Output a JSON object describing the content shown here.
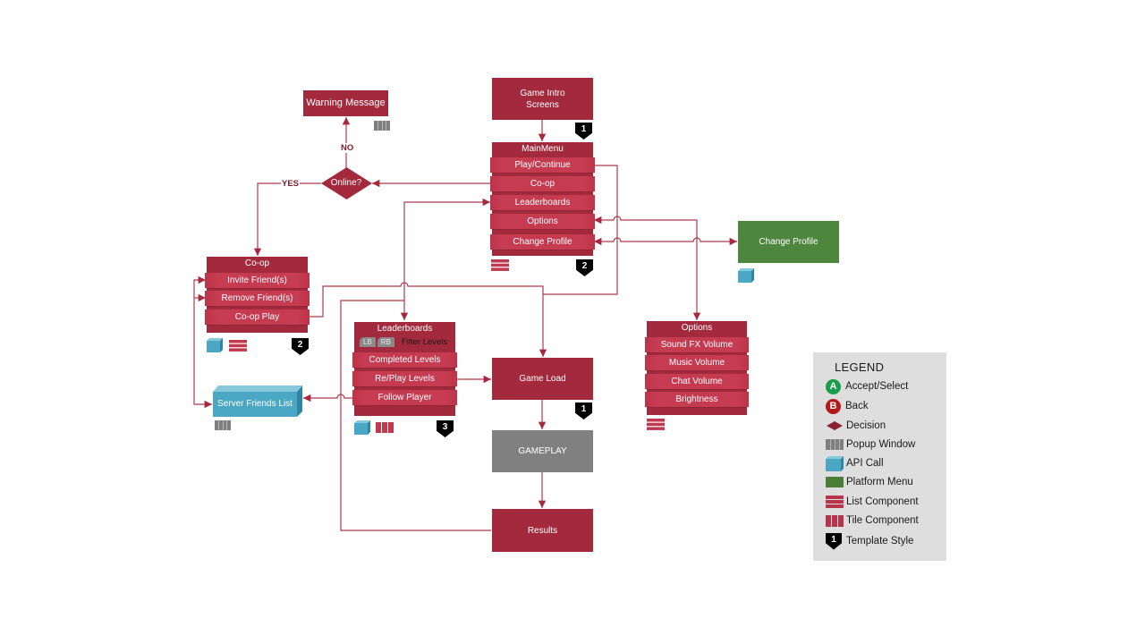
{
  "diagram": {
    "colors": {
      "node_red": "#a22a3c",
      "item_red": "#c43a4f",
      "platform_green": "#4f863e",
      "api_blue": "#4aa8c4",
      "gameplay_gray": "#808080",
      "popup_gray": "#7a7a7a",
      "connector": "#a8283d",
      "accept_green": "#1a9e4a",
      "back_red": "#b51a1a",
      "legend_bg": "#dedede"
    },
    "nodes": {
      "warning_message": {
        "label": "Warning Message",
        "icons": [
          "popup-window"
        ]
      },
      "game_intro": {
        "lines": [
          "Game Intro",
          "Screens"
        ],
        "template": "1"
      },
      "decision_online": {
        "label": "Online?"
      },
      "main_menu": {
        "title": "MainMenu",
        "items": [
          "Play/Continue",
          "Co-op",
          "Leaderboards",
          "Options",
          "Change Profile"
        ],
        "icons": [
          "list-component"
        ],
        "template": "2"
      },
      "coop": {
        "title": "Co-op",
        "items": [
          "Invite Friend(s)",
          "Remove Friend(s)",
          "Co-op Play"
        ],
        "icons": [
          "api-call",
          "list-component"
        ],
        "template": "2"
      },
      "leaderboards": {
        "title": "Leaderboards",
        "filter": {
          "buttons": [
            "LB",
            "RB"
          ],
          "label": "Filter Levels"
        },
        "items": [
          "Completed Levels",
          "Re/Play Levels",
          "Follow Player"
        ],
        "icons": [
          "api-call",
          "tile-component"
        ],
        "template": "3"
      },
      "server_friends_list": {
        "label": "Server Friends List",
        "type": "api-call",
        "icons": [
          "popup-window"
        ]
      },
      "game_load": {
        "label": "Game Load",
        "template": "1"
      },
      "gameplay": {
        "label": "GAMEPLAY"
      },
      "results": {
        "label": "Results"
      },
      "change_profile_platform": {
        "label": "Change Profile",
        "type": "platform-menu",
        "icons": [
          "api-call"
        ]
      },
      "options": {
        "title": "Options",
        "items": [
          "Sound FX Volume",
          "Music Volume",
          "Chat Volume",
          "Brightness"
        ],
        "icons": [
          "list-component"
        ]
      }
    },
    "edge_labels": {
      "yes": "YES",
      "no": "NO"
    },
    "edges": [
      {
        "from": "game_intro",
        "to": "main_menu"
      },
      {
        "from": "main_menu.Co-op",
        "to": "decision_online"
      },
      {
        "from": "decision_online",
        "to": "warning_message",
        "label": "NO"
      },
      {
        "from": "decision_online",
        "to": "coop",
        "label": "YES"
      },
      {
        "from": "main_menu.Play/Continue",
        "to": "game_load"
      },
      {
        "from": "coop.Co-op Play",
        "to": "game_load"
      },
      {
        "from": "main_menu.Leaderboards",
        "to": "leaderboards",
        "bidirectional": true
      },
      {
        "from": "results",
        "to": "leaderboards"
      },
      {
        "from": "leaderboards.Re/Play Levels",
        "to": "game_load"
      },
      {
        "from": "leaderboards.Follow Player",
        "to": "server_friends_list"
      },
      {
        "from": "server_friends_list",
        "to": "coop.Invite Friend(s)"
      },
      {
        "from": "server_friends_list",
        "to": "coop.Remove Friend(s)"
      },
      {
        "from": "game_load",
        "to": "gameplay"
      },
      {
        "from": "gameplay",
        "to": "results"
      },
      {
        "from": "main_menu.Options",
        "to": "options",
        "bidirectional": true
      },
      {
        "from": "main_menu.Change Profile",
        "to": "change_profile_platform",
        "bidirectional": true
      }
    ],
    "legend": {
      "title": "LEGEND",
      "items": [
        {
          "icon": "accept-button-icon",
          "glyph": "A",
          "label": "Accept/Select"
        },
        {
          "icon": "back-button-icon",
          "glyph": "B",
          "label": "Back"
        },
        {
          "icon": "decision-icon",
          "label": "Decision"
        },
        {
          "icon": "popup-window-icon",
          "label": "Popup Window"
        },
        {
          "icon": "api-call-icon",
          "label": "API Call"
        },
        {
          "icon": "platform-menu-icon",
          "label": "Platform Menu"
        },
        {
          "icon": "list-component-icon",
          "label": "List Component"
        },
        {
          "icon": "tile-component-icon",
          "label": "Tile Component"
        },
        {
          "icon": "template-style-icon",
          "glyph": "1",
          "label": "Template Style"
        }
      ]
    }
  }
}
